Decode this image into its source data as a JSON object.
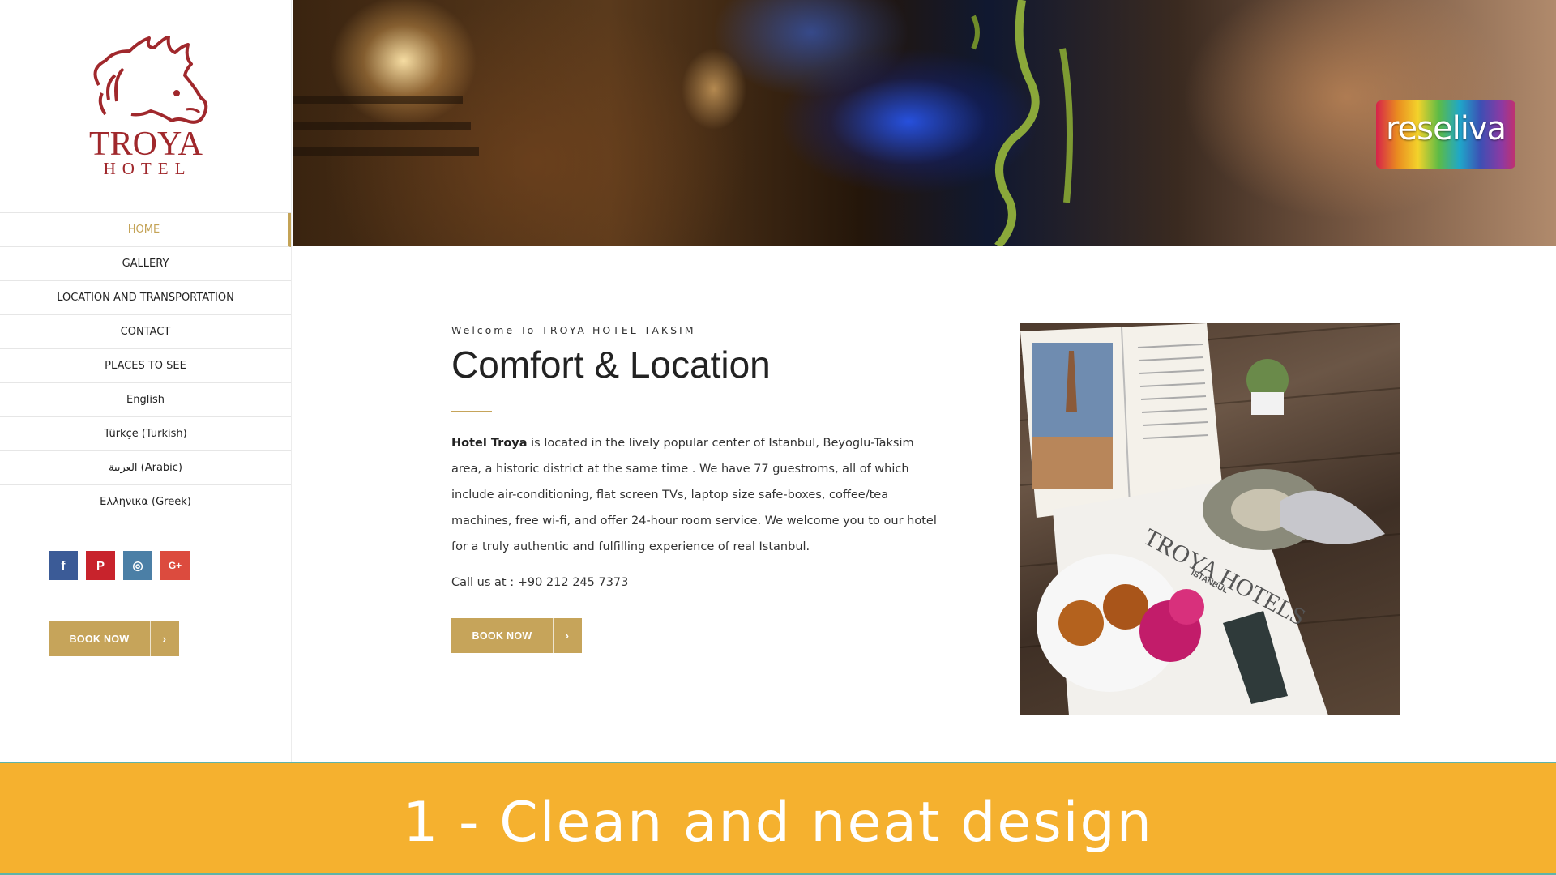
{
  "logo": {
    "name": "TROYA",
    "subtitle": "HOTEL"
  },
  "nav": [
    {
      "label": "HOME",
      "active": true
    },
    {
      "label": "GALLERY"
    },
    {
      "label": "LOCATION AND TRANSPORTATION"
    },
    {
      "label": "CONTACT"
    },
    {
      "label": "PLACES TO SEE"
    },
    {
      "label": "English"
    },
    {
      "label": "Türkçe (Turkish)"
    },
    {
      "label": "العربية (Arabic)"
    },
    {
      "label": "Ελληνικα (Greek)"
    }
  ],
  "social": {
    "facebook": "f",
    "pinterest": "P",
    "instagram": "◎",
    "googleplus": "G+"
  },
  "book_now": {
    "label": "BOOK NOW",
    "arrow": "›"
  },
  "hero": {
    "badge": "reseliva"
  },
  "content": {
    "welcome": "Welcome To TROYA HOTEL TAKSIM",
    "title": "Comfort & Location",
    "desc_bold": "Hotel Troya",
    "desc": " is located in the lively popular center of Istanbul, Beyoglu-Taksim area, a historic district at the same time . We have 77 guestroms, all of which include air-conditioning, flat screen TVs, laptop size safe-boxes, coffee/tea machines, free wi-fi, and offer 24-hour room service. We welcome you to our hotel for a truly authentic and fulfilling experience of real Istanbul.",
    "call": "Call us at : +90 212 245 7373"
  },
  "photo": {
    "brand": "TROYA HOTELS",
    "city": "ISTANBUL"
  },
  "banner": {
    "text": "1 - Clean and neat design"
  },
  "colors": {
    "gold": "#c6a45a",
    "banner": "#f5b12f",
    "logo": "#a0282c"
  }
}
